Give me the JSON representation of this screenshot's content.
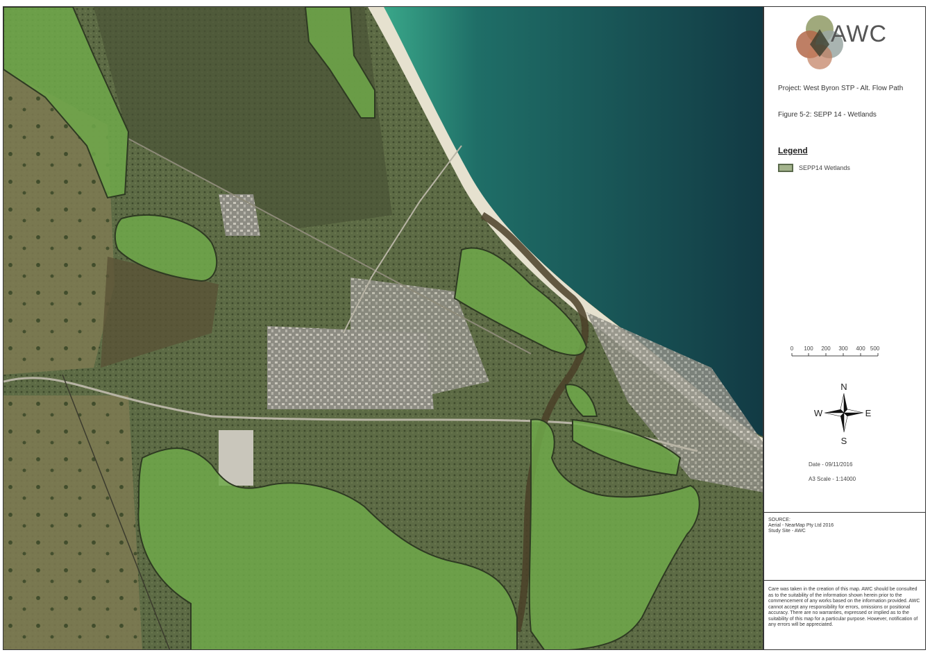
{
  "logo": {
    "text": "AWC"
  },
  "info": {
    "project": "Project: West Byron STP - Alt. Flow Path",
    "figure": "Figure 5-2: SEPP 14 - Wetlands"
  },
  "legend": {
    "title": "Legend",
    "items": [
      {
        "label": "SEPP14 Wetlands",
        "color": "#a3b38c"
      }
    ]
  },
  "scalebar": {
    "ticks": [
      "0",
      "100",
      "200",
      "300",
      "400",
      "500 m"
    ]
  },
  "north_arrow": {
    "n": "N",
    "s": "S",
    "e": "E",
    "w": "W"
  },
  "date": "Date - 09/11/2016",
  "scale": "A3 Scale - 1:14000",
  "source": {
    "title": "SOURCE:",
    "lines": [
      "Aerial - NearMap Pty Ltd 2016",
      "Study Site - AWC"
    ]
  },
  "disclaimer": "Care was taken in the creation of this map. AWC should be consulted as to the suitability of the information shown herein prior to the commencement of any works based on the information provided. AWC cannot accept any responsibility for errors, omissions or positional accuracy. There are no warranties, expressed or implied as to the suitability of this map for a particular purpose. However, notification of any errors will be appreciated.",
  "colors": {
    "ocean_deep": "#143c44",
    "ocean_shallow": "#2f8f7a",
    "beach": "#e8e3d2",
    "land": "#4b5a38",
    "wetland_fill": "#6fa84a",
    "wetland_border": "#2e3a22",
    "urban": "#9b9a92"
  }
}
